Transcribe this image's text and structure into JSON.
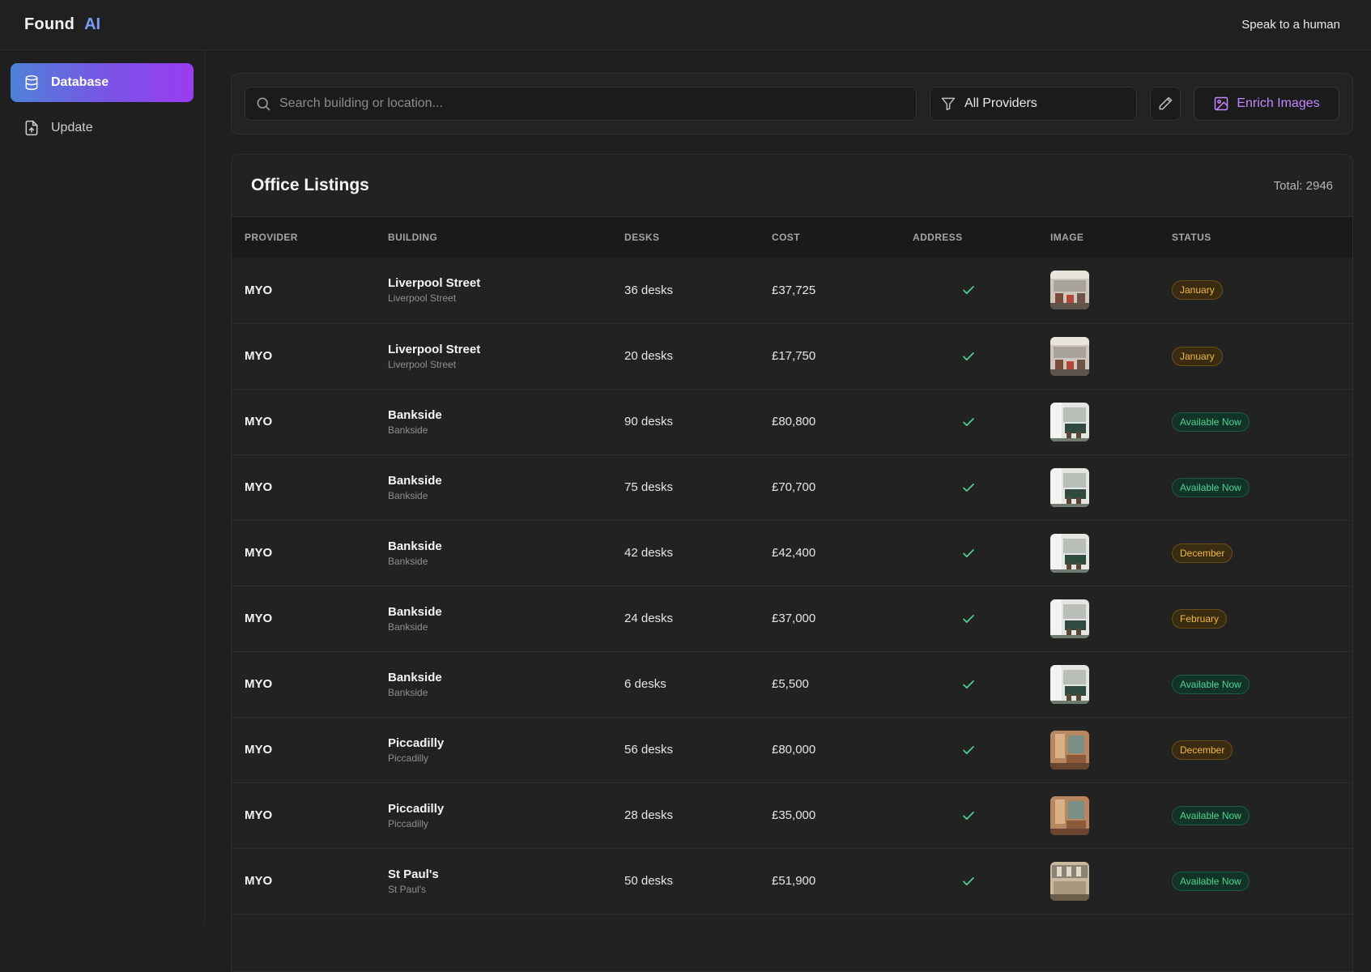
{
  "header": {
    "logo_main": "Found",
    "logo_ai": "AI",
    "speak_link": "Speak to a human"
  },
  "sidebar": {
    "items": [
      {
        "label": "Database",
        "icon": "database-icon",
        "active": true
      },
      {
        "label": "Update",
        "icon": "file-upload-icon",
        "active": false
      }
    ]
  },
  "toolbar": {
    "search_placeholder": "Search building or location...",
    "providers_label": "All Providers",
    "enrich_label": "Enrich Images"
  },
  "listings": {
    "title": "Office Listings",
    "total": "Total: 2946",
    "columns": [
      "PROVIDER",
      "BUILDING",
      "DESKS",
      "COST",
      "ADDRESS",
      "IMAGE",
      "STATUS"
    ],
    "rows": [
      {
        "provider": "MYO",
        "building": "Liverpool Street",
        "location": "Liverpool Street",
        "desks": "36 desks",
        "cost": "£37,725",
        "status": "January",
        "status_type": "month",
        "image": "office-a"
      },
      {
        "provider": "MYO",
        "building": "Liverpool Street",
        "location": "Liverpool Street",
        "desks": "20 desks",
        "cost": "£17,750",
        "status": "January",
        "status_type": "month",
        "image": "office-a"
      },
      {
        "provider": "MYO",
        "building": "Bankside",
        "location": "Bankside",
        "desks": "90 desks",
        "cost": "£80,800",
        "status": "Available Now",
        "status_type": "avail",
        "image": "office-b"
      },
      {
        "provider": "MYO",
        "building": "Bankside",
        "location": "Bankside",
        "desks": "75 desks",
        "cost": "£70,700",
        "status": "Available Now",
        "status_type": "avail",
        "image": "office-b"
      },
      {
        "provider": "MYO",
        "building": "Bankside",
        "location": "Bankside",
        "desks": "42 desks",
        "cost": "£42,400",
        "status": "December",
        "status_type": "month",
        "image": "office-b"
      },
      {
        "provider": "MYO",
        "building": "Bankside",
        "location": "Bankside",
        "desks": "24 desks",
        "cost": "£37,000",
        "status": "February",
        "status_type": "month",
        "image": "office-b"
      },
      {
        "provider": "MYO",
        "building": "Bankside",
        "location": "Bankside",
        "desks": "6 desks",
        "cost": "£5,500",
        "status": "Available Now",
        "status_type": "avail",
        "image": "office-b"
      },
      {
        "provider": "MYO",
        "building": "Piccadilly",
        "location": "Piccadilly",
        "desks": "56 desks",
        "cost": "£80,000",
        "status": "December",
        "status_type": "month",
        "image": "office-c"
      },
      {
        "provider": "MYO",
        "building": "Piccadilly",
        "location": "Piccadilly",
        "desks": "28 desks",
        "cost": "£35,000",
        "status": "Available Now",
        "status_type": "avail",
        "image": "office-c"
      },
      {
        "provider": "MYO",
        "building": "St Paul's",
        "location": "St Paul's",
        "desks": "50 desks",
        "cost": "£51,900",
        "status": "Available Now",
        "status_type": "avail",
        "image": "office-d"
      }
    ]
  },
  "colors": {
    "accent_gradient_start": "#4f82d8",
    "accent_gradient_end": "#9b3cf0",
    "enrich_text": "#c487ff",
    "check": "#4fd493",
    "status_month": "#f0b83c",
    "status_available": "#4fd493"
  }
}
